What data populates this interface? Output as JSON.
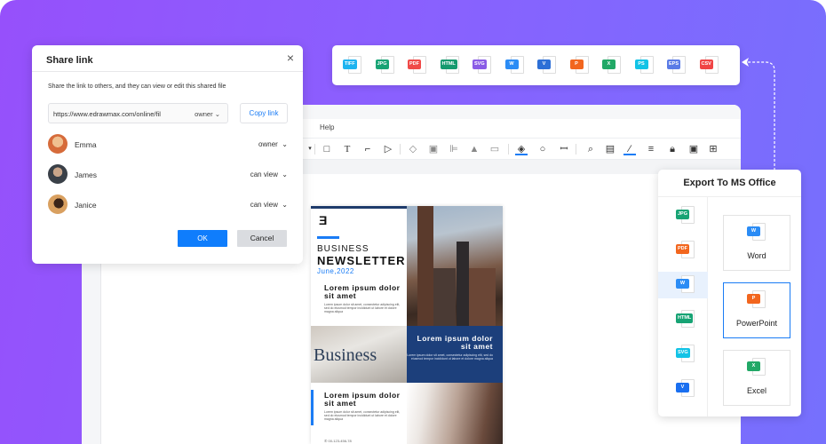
{
  "editor": {
    "menu_help": "Help",
    "toolbar_icons": [
      "chevron-icon",
      "rectangle-icon",
      "text-icon",
      "connector-icon",
      "pointer-icon",
      "layers-icon",
      "group-icon",
      "align-icon",
      "flip-icon",
      "frame-icon",
      "fill-icon",
      "shape-style-icon",
      "crop-icon",
      "search-icon",
      "find-replace-icon",
      "line-color-icon",
      "line-style-icon",
      "lock-icon",
      "fit-icon",
      "more-icon"
    ]
  },
  "newsletter": {
    "logo": "Ǝ",
    "business": "BUSINESS",
    "newsletter": "NEWSLETTER",
    "date": "June,2022",
    "block_heading": "Lorem  ipsum dolor sit amet",
    "block_text": "Lorem ipsum dolor sit amet, consectetur adipiscing elit, sed do eiusmod tempor incididunt ut labore et dolore magna aliqua",
    "image_word": "Business",
    "phone": "00-123-456-78"
  },
  "share_dialog": {
    "title": "Share link",
    "close_icon": "×",
    "description": "Share the link to others, and they can view or edit this shared file",
    "link_url": "https://www.edrawmax.com/online/fil",
    "link_permission": "owner",
    "copy_label": "Copy link",
    "users": [
      {
        "name": "Emma",
        "permission": "owner",
        "color": "#d66b3a"
      },
      {
        "name": "James",
        "permission": "can view",
        "color": "#3a4048"
      },
      {
        "name": "Janice",
        "permission": "can view",
        "color": "#d9a060"
      }
    ],
    "ok_label": "OK",
    "cancel_label": "Cancel"
  },
  "formats": [
    {
      "label": "TIFF",
      "color": "#1eb4f0"
    },
    {
      "label": "JPG",
      "color": "#17a374"
    },
    {
      "label": "PDF",
      "color": "#f04a48"
    },
    {
      "label": "HTML",
      "color": "#159a6e"
    },
    {
      "label": "SVG",
      "color": "#8a5ce6"
    },
    {
      "label": "W",
      "color": "#2b8cf5"
    },
    {
      "label": "V",
      "color": "#2d6fd6"
    },
    {
      "label": "P",
      "color": "#f2661e"
    },
    {
      "label": "X",
      "color": "#21a866"
    },
    {
      "label": "PS",
      "color": "#12c3e6"
    },
    {
      "label": "EPS",
      "color": "#5a7be6"
    },
    {
      "label": "CSV",
      "color": "#f04445"
    }
  ],
  "export_panel": {
    "title": "Export To MS Office",
    "side_items": [
      {
        "label": "JPG",
        "color": "#17a374",
        "active": false
      },
      {
        "label": "PDF",
        "color": "#f2661e",
        "active": false
      },
      {
        "label": "W",
        "color": "#2b8cf5",
        "active": true
      },
      {
        "label": "HTML",
        "color": "#17a374",
        "active": false
      },
      {
        "label": "SVG",
        "color": "#12c3e6",
        "active": false
      },
      {
        "label": "V",
        "color": "#1a6ff0",
        "active": false
      }
    ],
    "cards": [
      {
        "label": "Word",
        "tag": "W",
        "color": "#2b8cf5",
        "selected": false
      },
      {
        "label": "PowerPoint",
        "tag": "P",
        "color": "#f2661e",
        "selected": true
      },
      {
        "label": "Excel",
        "tag": "X",
        "color": "#21a866",
        "selected": false
      }
    ]
  }
}
